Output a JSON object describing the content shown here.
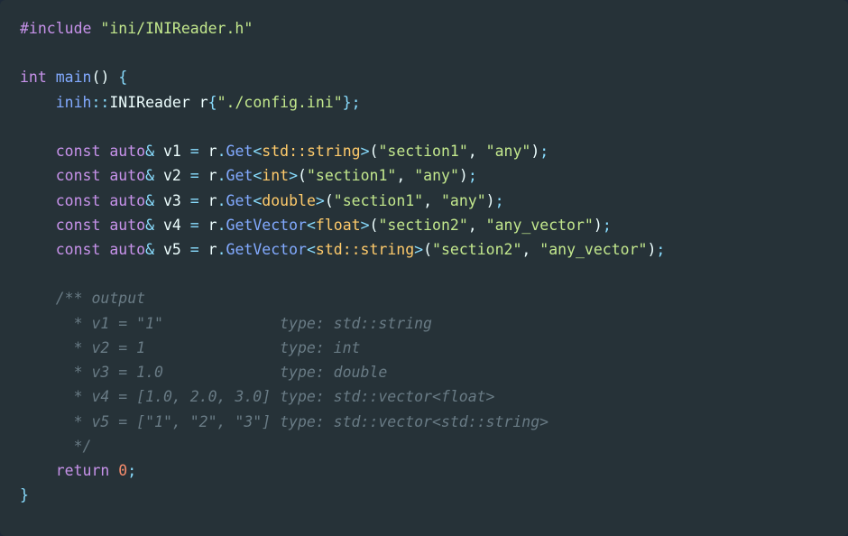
{
  "include_path": "\"ini/INIReader.h\"",
  "main_decl": {
    "ret": "int",
    "name": "main"
  },
  "reader_line": {
    "ns": "inih",
    "cls": "INIReader",
    "var": "r",
    "path": "\"./config.ini\""
  },
  "stmts": [
    {
      "var": "v1",
      "method": "Get",
      "tpl": "std::string",
      "sec": "\"section1\"",
      "key": "\"any\""
    },
    {
      "var": "v2",
      "method": "Get",
      "tpl": "int",
      "sec": "\"section1\"",
      "key": "\"any\""
    },
    {
      "var": "v3",
      "method": "Get",
      "tpl": "double",
      "sec": "\"section1\"",
      "key": "\"any\""
    },
    {
      "var": "v4",
      "method": "GetVector",
      "tpl": "float",
      "sec": "\"section2\"",
      "key": "\"any_vector\""
    },
    {
      "var": "v5",
      "method": "GetVector",
      "tpl": "std::string",
      "sec": "\"section2\"",
      "key": "\"any_vector\""
    }
  ],
  "comment_lines": [
    "/** output",
    " * v1 = \"1\"             type: std::string",
    " * v2 = 1               type: int",
    " * v3 = 1.0             type: double",
    " * v4 = [1.0, 2.0, 3.0] type: std::vector<float>",
    " * v5 = [\"1\", \"2\", \"3\"] type: std::vector<std::string>",
    " */"
  ],
  "return_val": "0",
  "tokens": {
    "hash_include": "#include",
    "const": "const",
    "auto": "auto",
    "amp": "&",
    "eq": "=",
    "lt": "<",
    "gt": ">",
    "dot": ".",
    "dcolon": "::",
    "lp": "(",
    "rp": ")",
    "lb": "{",
    "rb": "}",
    "semi": ";",
    "comma": ", ",
    "return": "return",
    "sp": " "
  }
}
